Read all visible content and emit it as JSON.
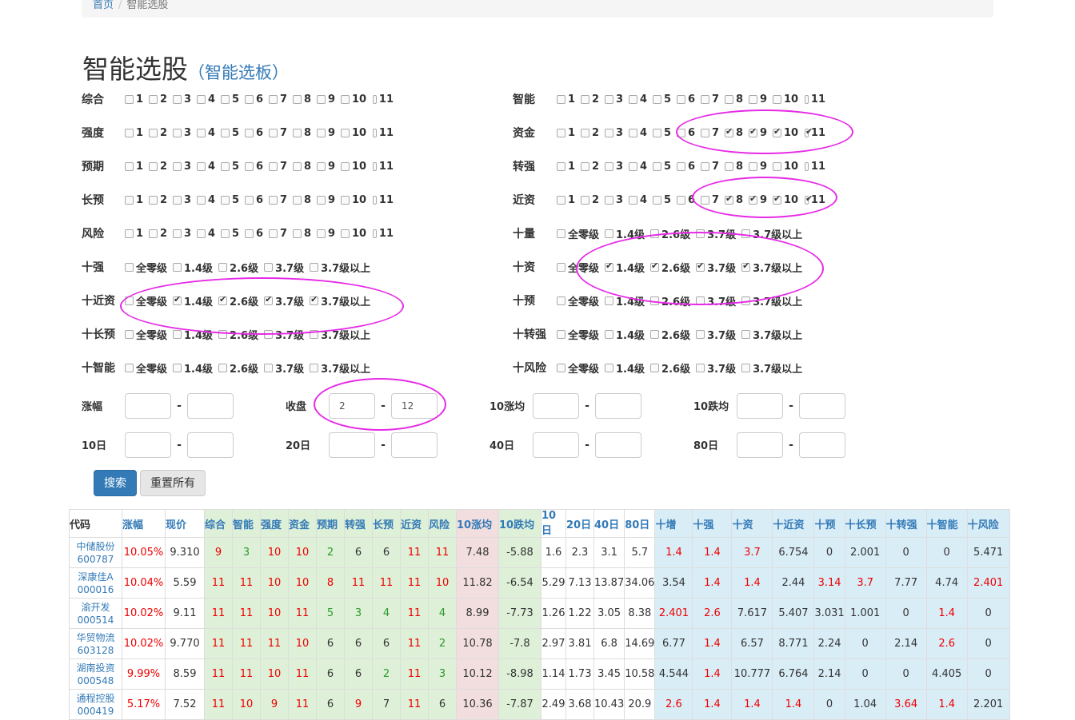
{
  "breadcrumb": {
    "home": "首页",
    "current": "智能选股"
  },
  "title": "智能选股",
  "subtitle": "（智能选板）",
  "nums": [
    "1",
    "2",
    "3",
    "4",
    "5",
    "6",
    "7",
    "8",
    "9",
    "10",
    "11"
  ],
  "grades": [
    "全零级",
    "1.4级",
    "2.6级",
    "3.7级",
    "3.7级以上"
  ],
  "filters_left": [
    {
      "label": "综合",
      "type": "num",
      "checked": []
    },
    {
      "label": "强度",
      "type": "num",
      "checked": []
    },
    {
      "label": "预期",
      "type": "num",
      "checked": []
    },
    {
      "label": "长预",
      "type": "num",
      "checked": []
    },
    {
      "label": "风险",
      "type": "num",
      "checked": []
    },
    {
      "label": "十强",
      "type": "grade",
      "checked": []
    },
    {
      "label": "十近资",
      "type": "grade",
      "checked": [
        1,
        2,
        3,
        4
      ]
    },
    {
      "label": "十长预",
      "type": "grade",
      "checked": []
    },
    {
      "label": "十智能",
      "type": "grade",
      "checked": []
    }
  ],
  "filters_right": [
    {
      "label": "智能",
      "type": "num",
      "checked": []
    },
    {
      "label": "资金",
      "type": "num",
      "checked": [
        7,
        8,
        9,
        10
      ]
    },
    {
      "label": "转强",
      "type": "num",
      "checked": []
    },
    {
      "label": "近资",
      "type": "num",
      "checked": [
        7,
        8,
        9,
        10
      ]
    },
    {
      "label": "十量",
      "type": "grade",
      "checked": []
    },
    {
      "label": "十资",
      "type": "grade",
      "checked": [
        1,
        2,
        3,
        4
      ]
    },
    {
      "label": "十预",
      "type": "grade",
      "checked": []
    },
    {
      "label": "十转强",
      "type": "grade",
      "checked": []
    },
    {
      "label": "十风险",
      "type": "grade",
      "checked": []
    }
  ],
  "ranges": [
    {
      "label": "涨幅",
      "from": "",
      "to": ""
    },
    {
      "label": "收盘",
      "from": "2",
      "to": "12"
    },
    {
      "label": "10涨均",
      "from": "",
      "to": ""
    },
    {
      "label": "10跌均",
      "from": "",
      "to": ""
    },
    {
      "label": "10日",
      "from": "",
      "to": ""
    },
    {
      "label": "20日",
      "from": "",
      "to": ""
    },
    {
      "label": "40日",
      "from": "",
      "to": ""
    },
    {
      "label": "80日",
      "from": "",
      "to": ""
    }
  ],
  "buttons": {
    "search": "搜索",
    "reset": "重置所有"
  },
  "annotation_color": "#e62ae6",
  "table": {
    "headers": [
      "代码",
      "涨幅",
      "现价",
      "综合",
      "智能",
      "强度",
      "资金",
      "预期",
      "转强",
      "长预",
      "近资",
      "风险",
      "10涨均",
      "10跌均",
      "10日",
      "20日",
      "40日",
      "80日",
      "十增",
      "十强",
      "十资",
      "十近资",
      "十预",
      "十长预",
      "十转强",
      "十智能",
      "十风险"
    ],
    "rows": [
      {
        "name": "中储股份",
        "code": "600787",
        "cells": [
          "10.05%",
          "9.310",
          "9",
          "3",
          "10",
          "10",
          "2",
          "6",
          "6",
          "11",
          "11",
          "7.48",
          "-5.88",
          "1.6",
          "2.3",
          "3.1",
          "5.7",
          "1.4",
          "1.4",
          "3.7",
          "6.754",
          "0",
          "2.001",
          "0",
          "0",
          "5.471"
        ]
      },
      {
        "name": "深康佳A",
        "code": "000016",
        "cells": [
          "10.04%",
          "5.59",
          "11",
          "11",
          "10",
          "10",
          "8",
          "11",
          "11",
          "11",
          "10",
          "11.82",
          "-6.54",
          "5.29",
          "7.13",
          "13.87",
          "34.06",
          "3.54",
          "1.4",
          "1.4",
          "2.44",
          "3.14",
          "3.7",
          "7.77",
          "4.74",
          "2.401"
        ]
      },
      {
        "name": "渝开发",
        "code": "000514",
        "cells": [
          "10.02%",
          "9.11",
          "11",
          "11",
          "10",
          "11",
          "5",
          "3",
          "4",
          "11",
          "4",
          "8.99",
          "-7.73",
          "1.26",
          "1.22",
          "3.05",
          "8.38",
          "2.401",
          "2.6",
          "7.617",
          "5.407",
          "3.031",
          "1.001",
          "0",
          "1.4",
          "0"
        ]
      },
      {
        "name": "华贸物流",
        "code": "603128",
        "cells": [
          "10.02%",
          "9.770",
          "11",
          "11",
          "11",
          "10",
          "6",
          "6",
          "6",
          "11",
          "2",
          "10.78",
          "-7.8",
          "2.97",
          "3.81",
          "6.8",
          "14.69",
          "6.77",
          "1.4",
          "6.57",
          "8.771",
          "2.24",
          "0",
          "2.14",
          "2.6",
          "0"
        ]
      },
      {
        "name": "湖南投资",
        "code": "000548",
        "cells": [
          "9.99%",
          "8.59",
          "11",
          "11",
          "10",
          "11",
          "6",
          "6",
          "2",
          "11",
          "3",
          "10.12",
          "-8.98",
          "1.14",
          "1.73",
          "3.45",
          "10.58",
          "4.544",
          "1.4",
          "10.777",
          "6.764",
          "2.14",
          "0",
          "0",
          "4.405",
          "0"
        ]
      },
      {
        "name": "通程控股",
        "code": "000419",
        "cells": [
          "5.17%",
          "7.52",
          "11",
          "10",
          "9",
          "11",
          "6",
          "9",
          "7",
          "11",
          "6",
          "10.36",
          "-7.87",
          "2.49",
          "3.68",
          "10.43",
          "20.9",
          "2.6",
          "1.4",
          "1.4",
          "1.4",
          "0",
          "1.04",
          "3.64",
          "1.4",
          "2.201"
        ]
      }
    ]
  }
}
